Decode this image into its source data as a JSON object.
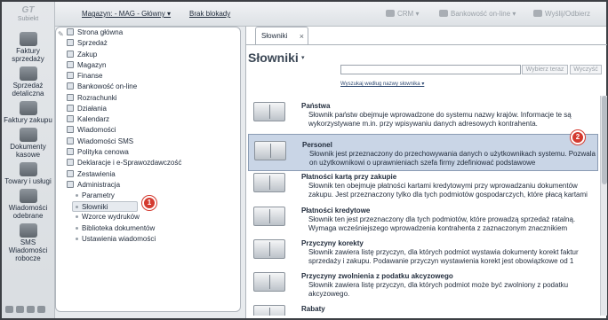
{
  "app": {
    "logo_text": "Subiekt"
  },
  "leftbar": {
    "items": [
      {
        "label": "Faktury sprzedaży"
      },
      {
        "label": "Sprzedaż detaliczna"
      },
      {
        "label": "Faktury zakupu"
      },
      {
        "label": "Dokumenty kasowe"
      },
      {
        "label": "Towary i usługi"
      },
      {
        "label": "Wiadomości odebrane"
      },
      {
        "label": "SMS Wiadomości robocze"
      }
    ]
  },
  "topbar": {
    "magazyn": "Magazyn: - MAG - Główny ▾",
    "brak_blokady": "Brak blokady",
    "crm": "CRM ▾",
    "bankowosc": "Bankowość on-line ▾",
    "wyslij": "Wyślij/Odbierz"
  },
  "tree": {
    "items": [
      {
        "label": "Strona główna"
      },
      {
        "label": "Sprzedaż"
      },
      {
        "label": "Zakup"
      },
      {
        "label": "Magazyn"
      },
      {
        "label": "Finanse"
      },
      {
        "label": "Bankowość on-line"
      },
      {
        "label": "Rozrachunki"
      },
      {
        "label": "Działania"
      },
      {
        "label": "Kalendarz"
      },
      {
        "label": "Wiadomości"
      },
      {
        "label": "Wiadomości SMS"
      },
      {
        "label": "Polityka cenowa"
      },
      {
        "label": "Deklaracje i e-Sprawozdawczość"
      },
      {
        "label": "Zestawienia"
      },
      {
        "label": "Administracja"
      }
    ],
    "sub_items": [
      {
        "label": "Parametry"
      },
      {
        "label": "Słowniki"
      },
      {
        "label": "Wzorce wydruków"
      },
      {
        "label": "Biblioteka dokumentów"
      },
      {
        "label": "Ustawienia wiadomości"
      }
    ],
    "selected": "Słowniki"
  },
  "badges": {
    "one": "1",
    "two": "2"
  },
  "main": {
    "tab_label": "Słowniki",
    "title": "Słowniki",
    "search": {
      "placeholder": "",
      "search_button": "Wybierz teraz",
      "clear_button": "Wyczyść",
      "search_by": "Wyszukaj według nazwy słownika ▾"
    },
    "items": [
      {
        "title": "Państwa",
        "desc": "Słownik państw obejmuje wprowadzone do systemu nazwy krajów. Informacje te są wykorzystywane m.in. przy wpisywaniu danych adresowych kontrahenta."
      },
      {
        "title": "Personel",
        "desc": "Słownik jest przeznaczony do przechowywania danych o użytkownikach systemu. Pozwala on użytkownikowi o uprawnieniach szefa firmy zdefiniować podstawowe"
      },
      {
        "title": "Płatności kartą przy zakupie",
        "desc": "Słownik ten obejmuje płatności kartami kredytowymi przy wprowadzaniu dokumentów zakupu. Jest przeznaczony tylko dla tych podmiotów gospodarczych, które płacą kartami"
      },
      {
        "title": "Płatności kredytowe",
        "desc": "Słownik ten jest przeznaczony dla tych podmiotów, które prowadzą sprzedaż ratalną. Wymaga wcześniejszego wprowadzenia kontrahenta z zaznaczonym znacznikiem"
      },
      {
        "title": "Przyczyny korekty",
        "desc": "Słownik zawiera listę przyczyn, dla których podmiot wystawia dokumenty korekt faktur sprzedaży i zakupu. Podawanie przyczyn wystawienia korekt jest obowiązkowe od 1"
      },
      {
        "title": "Przyczyny zwolnienia z podatku akcyzowego",
        "desc": "Słownik zawiera listę przyczyn, dla których podmiot może być zwolniony z podatku akcyzowego."
      },
      {
        "title": "Rabaty",
        "desc": ""
      }
    ]
  }
}
